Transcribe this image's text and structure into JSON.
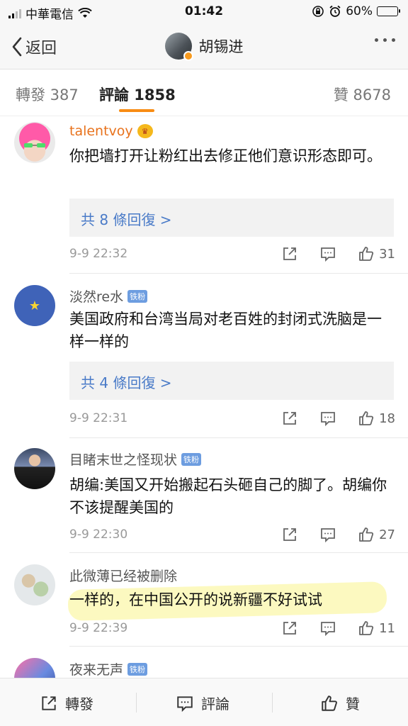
{
  "status_bar": {
    "carrier": "中華電信",
    "time": "01:42",
    "battery": "60%",
    "battery_level": 0.6
  },
  "nav": {
    "back_label": "返回",
    "title": "胡锡进"
  },
  "tabs": {
    "forward": "轉發 387",
    "comment": "評論 1858",
    "like": "贊 8678"
  },
  "comments": [
    {
      "name": "talentvoy",
      "text": "你把墙打开让粉红出去修正他们意识形态即可。",
      "replies": "共 8 條回復 >",
      "time": "9-9 22:32",
      "likes": "31"
    },
    {
      "name": "淡然re水",
      "badge": "铁粉",
      "text": "美国政府和台湾当局对老百姓的封闭式洗脑是一样一样的",
      "replies": "共 4 條回復 >",
      "time": "9-9 22:31",
      "likes": "18"
    },
    {
      "name": "目睹末世之怪现状",
      "badge": "铁粉",
      "text": "胡编:美国又开始搬起石头砸自己的脚了。胡编你不该提醒美国的",
      "time": "9-9 22:30",
      "likes": "27"
    },
    {
      "name": "此微薄已经被删除",
      "text": "一样的，在中国公开的说新疆不好试试",
      "time": "9-9 22:39",
      "likes": "11"
    },
    {
      "name": "夜来无声",
      "badge": "铁粉"
    }
  ],
  "bottom_bar": {
    "forward": "轉發",
    "comment": "評論",
    "like": "贊"
  },
  "colors": {
    "accent": "#f88c13",
    "link": "#4a7bc8",
    "name_orange": "#e8721c"
  }
}
